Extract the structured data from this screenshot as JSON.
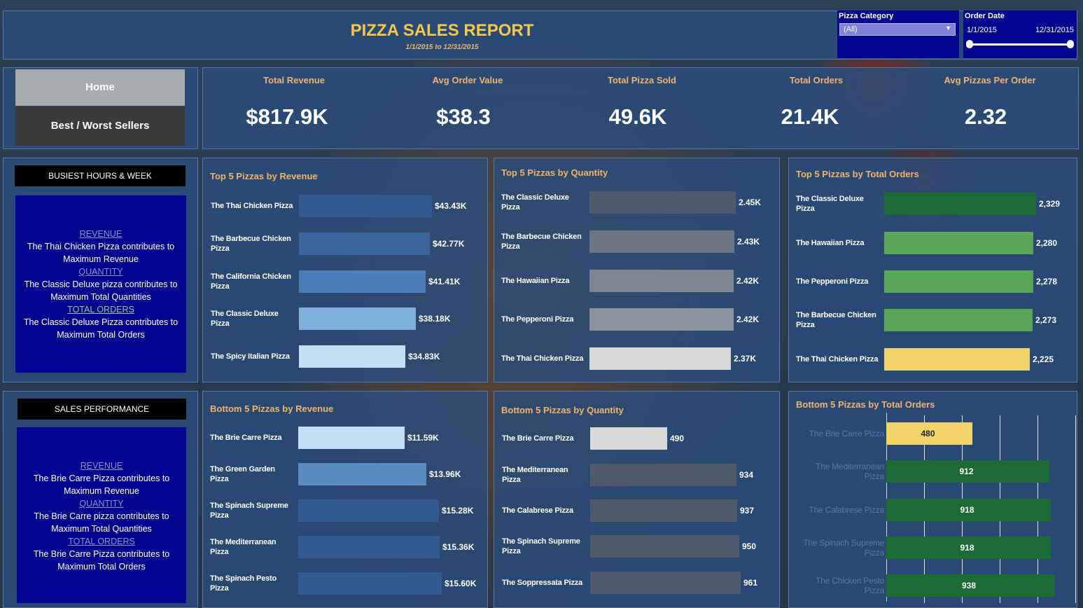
{
  "header": {
    "title": "PIZZA SALES REPORT",
    "subtitle": "1/1/2015 to 12/31/2015"
  },
  "filters": {
    "category_label": "Pizza Category",
    "category_value": "(All)",
    "date_label": "Order Date",
    "date_start": "1/1/2015",
    "date_end": "12/31/2015"
  },
  "nav": {
    "home": "Home",
    "best_worst": "Best / Worst Sellers"
  },
  "kpis": [
    {
      "label": "Total Revenue",
      "value": "$817.9K"
    },
    {
      "label": "Avg Order Value",
      "value": "$38.3"
    },
    {
      "label": "Total Pizza Sold",
      "value": "49.6K"
    },
    {
      "label": "Total Orders",
      "value": "21.4K"
    },
    {
      "label": "Avg Pizzas Per Order",
      "value": "2.32"
    }
  ],
  "busiest": {
    "header": "BUSIEST HOURS & WEEK",
    "lines": [
      {
        "h": "REVENUE",
        "t1": "The Thai Chicken Pizza contributes to",
        "t2": "Maximum Revenue"
      },
      {
        "h": "QUANTITY",
        "t1": "The Classic Deluxe pizza contributes to",
        "t2": "Maximum Total Quantities"
      },
      {
        "h": "TOTAL ORDERS",
        "t1": "The Classic Deluxe Pizza contributes to",
        "t2": "Maximum Total Orders"
      }
    ]
  },
  "performance": {
    "header": "SALES PERFORMANCE",
    "lines": [
      {
        "h": "REVENUE",
        "t1": "The Brie Carre Pizza contributes to",
        "t2": "Maximum Revenue"
      },
      {
        "h": "QUANTITY",
        "t1": "The Brie Carre pizza contributes to",
        "t2": "Maximum Total Quantities"
      },
      {
        "h": "TOTAL ORDERS",
        "t1": "The Brie Carre Pizza contributes to",
        "t2": "Maximum Total Orders"
      }
    ]
  },
  "chart_data": [
    {
      "type": "bar",
      "title": "Top 5 Pizzas by Revenue",
      "categories": [
        "The Thai Chicken Pizza",
        "The Barbecue Chicken Pizza",
        "The California Chicken Pizza",
        "The Classic Deluxe Pizza",
        "The Spicy Italian Pizza"
      ],
      "values": [
        43.43,
        42.77,
        41.41,
        38.18,
        34.83
      ],
      "labels": [
        "$43.43K",
        "$42.77K",
        "$41.41K",
        "$38.18K",
        "$34.83K"
      ],
      "colors": [
        "#2f5b8f",
        "#3a669e",
        "#4a7cb6",
        "#7fb0dc",
        "#bfe0f5"
      ],
      "xlim": [
        0,
        48
      ]
    },
    {
      "type": "bar",
      "title": "Top 5 Pizzas by Quantity",
      "categories": [
        "The Classic Deluxe Pizza",
        "The Barbecue Chicken Pizza",
        "The Hawaiian Pizza",
        "The Pepperoni Pizza",
        "The Thai Chicken Pizza"
      ],
      "values": [
        2.45,
        2.43,
        2.42,
        2.42,
        2.37
      ],
      "labels": [
        "2.45K",
        "2.43K",
        "2.42K",
        "2.42K",
        "2.37K"
      ],
      "colors": [
        "#4f5a6a",
        "#6c7584",
        "#7c8591",
        "#8a929d",
        "#d9d9d9"
      ],
      "xlim": [
        0,
        2.58
      ]
    },
    {
      "type": "bar",
      "title": "Top 5 Pizzas by Total Orders",
      "categories": [
        "The Classic Deluxe Pizza",
        "The Hawaiian Pizza",
        "The Pepperoni Pizza",
        "The Barbecue Chicken Pizza",
        "The Thai Chicken Pizza"
      ],
      "values": [
        2329,
        2280,
        2278,
        2273,
        2225
      ],
      "labels": [
        "2,329",
        "2,280",
        "2,278",
        "2,273",
        "2,225"
      ],
      "colors": [
        "#1d6b34",
        "#5aa657",
        "#5aa657",
        "#5aa657",
        "#f3d368"
      ],
      "xlim": [
        0,
        2410
      ]
    },
    {
      "type": "bar",
      "title": "Bottom 5 Pizzas by Revenue",
      "categories": [
        "The Brie Carre Pizza",
        "The Green Garden Pizza",
        "The Spinach Supreme Pizza",
        "The Mediterranean Pizza",
        "The Spinach Pesto Pizza"
      ],
      "values": [
        11.59,
        13.96,
        15.28,
        15.36,
        15.6
      ],
      "labels": [
        "$11.59K",
        "$13.96K",
        "$15.28K",
        "$15.36K",
        "$15.60K"
      ],
      "colors": [
        "#bfe0f5",
        "#5a8cc2",
        "#2f5b8f",
        "#2f5b8f",
        "#2f5b8f"
      ],
      "xlim": [
        0,
        16.6
      ]
    },
    {
      "type": "bar",
      "title": "Bottom 5 Pizzas by Quantity",
      "categories": [
        "The Brie Carre Pizza",
        "The Mediterranean Pizza",
        "The Calabrese Pizza",
        "The Spinach Supreme Pizza",
        "The Soppressata Pizza"
      ],
      "values": [
        490,
        934,
        937,
        950,
        961
      ],
      "labels": [
        "490",
        "934",
        "937",
        "950",
        "961"
      ],
      "colors": [
        "#d9d9d9",
        "#4f5a6a",
        "#4f5a6a",
        "#4f5a6a",
        "#4f5a6a"
      ],
      "xlim": [
        0,
        1000
      ]
    },
    {
      "type": "bar",
      "title": "Bottom 5 Pizzas by Total Orders",
      "categories": [
        "The Brie Carre Pizza",
        "The Mediterranean Pizza",
        "The Calabrese Pizza",
        "The Spinach Supreme Pizza",
        "The Chicken Pesto Pizza"
      ],
      "values": [
        480,
        912,
        918,
        918,
        938
      ],
      "labels": [
        "480",
        "912",
        "918",
        "918",
        "938"
      ],
      "colors": [
        "#f3d368",
        "#1d6b34",
        "#1d6b34",
        "#1d6b34",
        "#1d6b34"
      ],
      "xlim": [
        0,
        1000
      ]
    }
  ]
}
